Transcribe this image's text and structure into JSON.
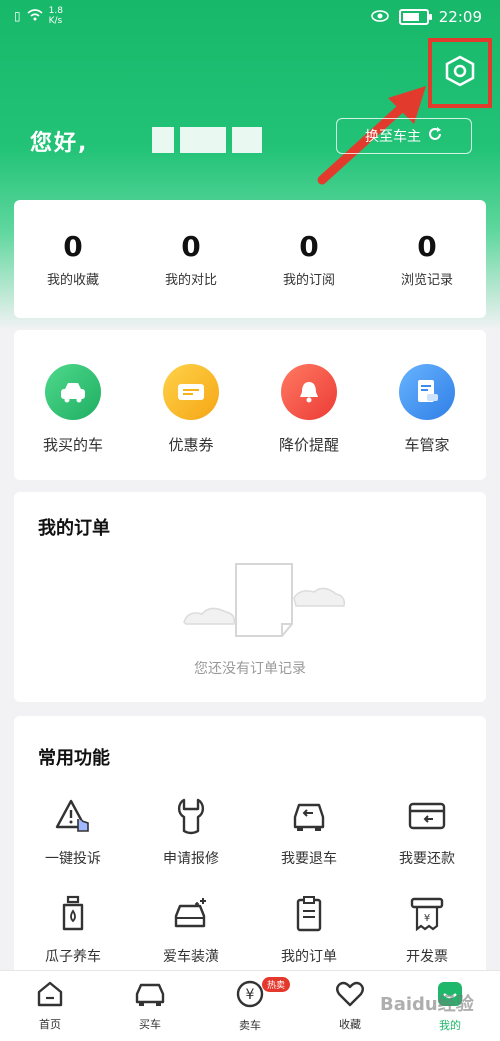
{
  "status_bar": {
    "network_speed": "1.8\nK/s",
    "time": "22:09"
  },
  "header": {
    "greeting": "您好,",
    "switch_button": "换至车主"
  },
  "stats": [
    {
      "value": "0",
      "label": "我的收藏"
    },
    {
      "value": "0",
      "label": "我的对比"
    },
    {
      "value": "0",
      "label": "我的订阅"
    },
    {
      "value": "0",
      "label": "浏览记录"
    }
  ],
  "services": [
    {
      "label": "我买的车",
      "icon": "car-icon",
      "color": "#2fbf72"
    },
    {
      "label": "优惠券",
      "icon": "coupon-icon",
      "color": "#f5b21c"
    },
    {
      "label": "降价提醒",
      "icon": "bell-icon",
      "color": "#f05548"
    },
    {
      "label": "车管家",
      "icon": "document-car-icon",
      "color": "#3a8df0"
    }
  ],
  "orders": {
    "title": "我的订单",
    "empty_text": "您还没有订单记录"
  },
  "common_functions": {
    "title": "常用功能",
    "items": [
      {
        "label": "一键投诉",
        "icon": "warning-hand-icon"
      },
      {
        "label": "申请报修",
        "icon": "wrench-icon"
      },
      {
        "label": "我要退车",
        "icon": "car-return-icon"
      },
      {
        "label": "我要还款",
        "icon": "card-icon"
      },
      {
        "label": "瓜子养车",
        "icon": "oil-bottle-icon"
      },
      {
        "label": "爱车装潢",
        "icon": "car-sparkle-icon"
      },
      {
        "label": "我的订单",
        "icon": "clipboard-icon"
      },
      {
        "label": "开发票",
        "icon": "invoice-icon"
      }
    ]
  },
  "tabbar": {
    "items": [
      {
        "label": "首页",
        "icon": "home-icon"
      },
      {
        "label": "买车",
        "icon": "car-outline-icon"
      },
      {
        "label": "卖车",
        "icon": "yuan-icon",
        "badge": "热卖"
      },
      {
        "label": "收藏",
        "icon": "heart-icon"
      },
      {
        "label": "我的",
        "icon": "profile-icon",
        "active": true
      }
    ]
  },
  "watermark": "Baidu经验",
  "colors": {
    "primary": "#1fb86b",
    "highlight": "#e23b2e"
  }
}
